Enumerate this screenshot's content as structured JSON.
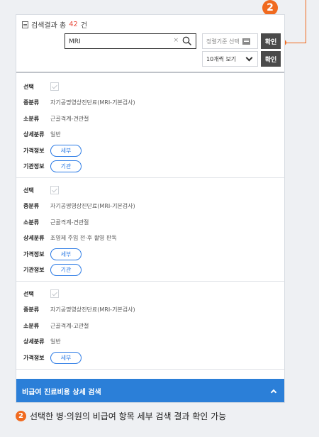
{
  "callout": {
    "number": "2"
  },
  "search": {
    "summary_prefix": "검색결과 총",
    "summary_count": "42",
    "summary_suffix": "건",
    "query": "MRI",
    "clear_symbol": "×",
    "sort_placeholder": "정렬기준 선택",
    "confirm_label": "확인",
    "page_size": "10개씩 보기",
    "confirm2_label": "확인"
  },
  "labels": {
    "select": "선택",
    "mid_category": "중분류",
    "sub_category": "소분류",
    "detail_category": "상세분류",
    "price_info": "가격정보",
    "org_info": "기관정보",
    "detail_button": "세부",
    "org_button": "기관"
  },
  "results": [
    {
      "mid_category": "자기공명영상진단료(MRI-기본검사)",
      "sub_category": "근골격계-견관절",
      "detail_category": "일반"
    },
    {
      "mid_category": "자기공명영상진단료(MRI-기본검사)",
      "sub_category": "근골격계-견관절",
      "detail_category": "조영제 주입 전·후 촬영 판독"
    },
    {
      "mid_category": "자기공명영상진단료(MRI-기본검사)",
      "sub_category": "근골격계-고관절",
      "detail_category": "일반"
    }
  ],
  "footer": {
    "title": "비급여 진료비용 상세 검색"
  },
  "caption": {
    "number": "2",
    "text": "선택한 병·의원의 비급여 항목 세부 검색 결과 확인 가능"
  },
  "colors": {
    "accent": "#f06a1f",
    "primary": "#2b7fd8",
    "pill": "#2c7be5",
    "count": "#e84c3d",
    "dark_button": "#4a4a4a"
  },
  "icons": [
    "document-icon",
    "search-icon",
    "sort-icon",
    "chevron-down-icon",
    "chevron-up-icon",
    "checkbox-icon"
  ]
}
